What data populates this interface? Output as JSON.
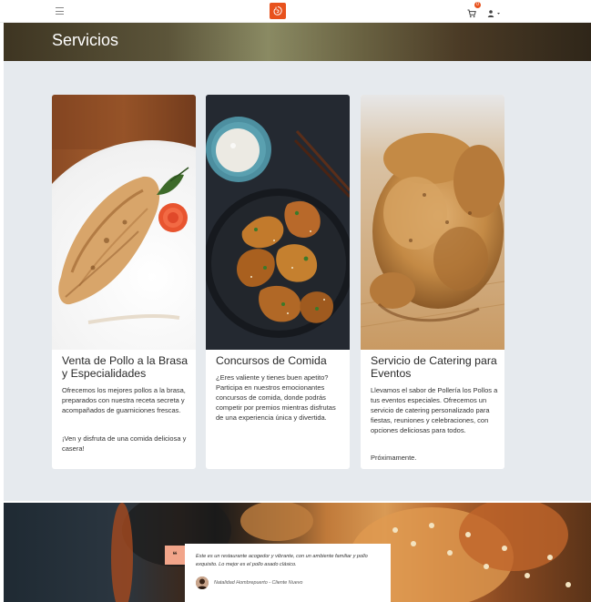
{
  "header": {
    "menu_icon": "hamburger-icon",
    "logo_icon": "chicken-logo-icon",
    "cart_icon": "cart-icon",
    "cart_count": "0",
    "user_icon": "user-icon",
    "accent_color": "#e8521d"
  },
  "banner": {
    "title": "Servicios"
  },
  "services": [
    {
      "title": "Venta de Pollo a la Brasa y Especialidades",
      "paragraphs": [
        "Ofrecemos los mejores pollos a la brasa, preparados con nuestra receta secreta y acompañados de guarniciones frescas.",
        "¡Ven y disfruta de una comida deliciosa y casera!"
      ]
    },
    {
      "title": "Concursos de Comida",
      "paragraphs": [
        "¿Eres valiente y tienes buen apetito? Participa en nuestros emocionantes concursos de comida, donde podrás competir por premios mientras disfrutas de una experiencia única y divertida."
      ]
    },
    {
      "title": "Servicio de Catering para Eventos",
      "paragraphs": [
        "Llevamos el sabor de Pollería los Pollos a tus eventos especiales. Ofrecemos un servicio de catering personalizado para fiestas, reuniones y celebraciones, con opciones deliciosas para todos.",
        "Próximamente."
      ]
    }
  ],
  "testimonial": {
    "quote_mark": "❝",
    "text": "Este es un restaurante acogedor y vibrante, con un ambiente familiar y pollo exquisito. Lo mejor es el pollo asado clásico.",
    "author": "Natalidad Hombrepuerto - Cliente Nuevo"
  }
}
